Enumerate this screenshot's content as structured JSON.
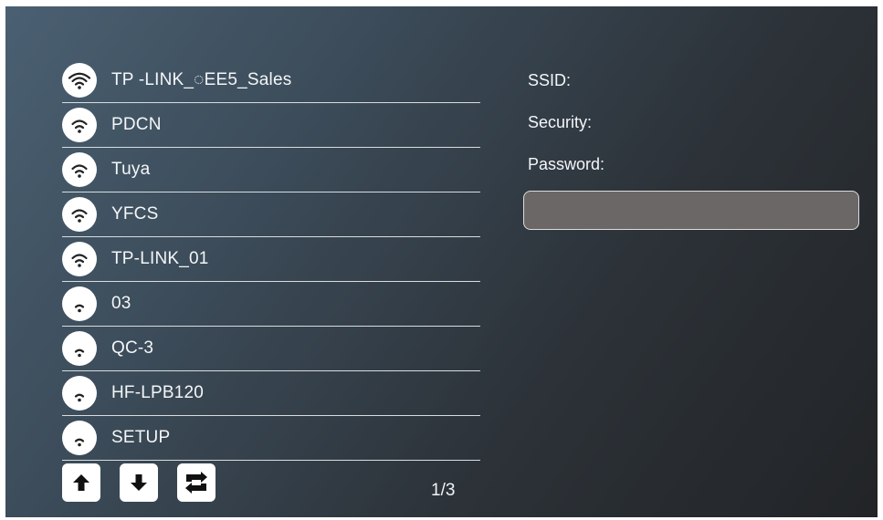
{
  "networks": [
    {
      "name": "TP -LINK_◌EE5_Sales",
      "signal_icon": "wifi-strong-icon"
    },
    {
      "name": "PDCN",
      "signal_icon": "wifi-strong-icon"
    },
    {
      "name": "Tuya",
      "signal_icon": "wifi-strong-icon"
    },
    {
      "name": "YFCS",
      "signal_icon": "wifi-strong-icon"
    },
    {
      "name": "TP-LINK_01",
      "signal_icon": "wifi-strong-icon"
    },
    {
      "name": "03",
      "signal_icon": "wifi-weak-icon"
    },
    {
      "name": "QC-3",
      "signal_icon": "wifi-weak-icon"
    },
    {
      "name": "HF-LPB120",
      "signal_icon": "wifi-weak-icon"
    },
    {
      "name": "SETUP",
      "signal_icon": "wifi-weak-icon"
    }
  ],
  "pagination": {
    "current": 1,
    "total": 3,
    "label": "1/3"
  },
  "controls": {
    "icons": [
      "arrow-up-icon",
      "arrow-down-icon",
      "refresh-icon"
    ]
  },
  "details": {
    "ssid_label": "SSID:",
    "security_label": "Security:",
    "password_label": "Password:",
    "password_value": ""
  },
  "colors": {
    "accent_white": "#ffffff",
    "password_field": "#6b6767",
    "background_start": "#4a6072",
    "background_end": "#222427"
  }
}
